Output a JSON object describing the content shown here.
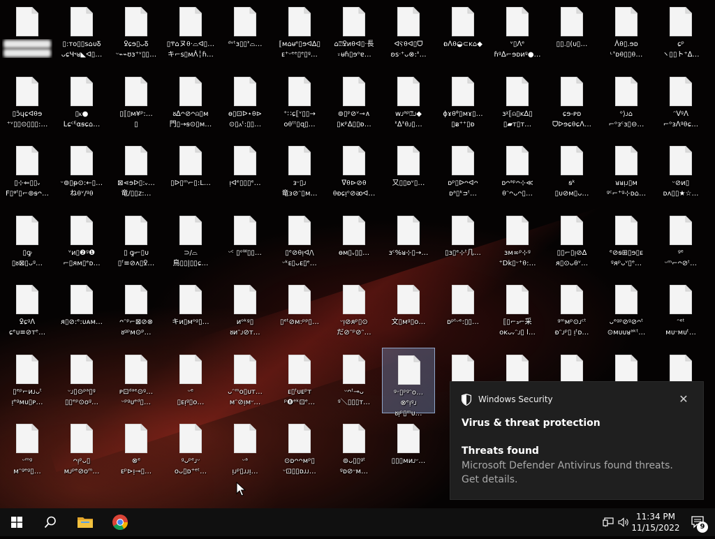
{
  "desktop": {
    "icons": [
      [
        "▪▪▪▪▪▪▪▪▪",
        "▪▪▪▪▪▪▪▪▪"
      ],
      [
        "▯:ᴛᴏ▯▯ꜱ⌂ᴜꝽ",
        "ᴗɕЧ˞ᴚ◣ᐊ▯…"
      ],
      [
        "ꝿɕɘ▯ᴗꝽ",
        "ᵕ⌁⌁ʊɜ⁺ᵛ▯▯…"
      ],
      [
        "▯ⰹ⌂ヌ⍬·⌓ᐊ▯…",
        "キ⌐ꜱ▯ᴍᐲ╎ɦ…"
      ],
      [
        "ᵈᵛᵗɜ▯▯ᕑ⌓…",
        ""
      ],
      [
        "⟦ᴍ⌂ᵾᵉ▯ɘᐊ∆▯",
        "ᴇ⁺ᵕᵉᵉ▯ᵉ▯ᵍ…"
      ],
      [
        "⌂⍰ꝿᴎ⍬ᐊ▯·長",
        "⍤ᵾɦ▯ɘᵒɐ…"
      ],
      [
        "ᐊⲊ⍬ᐊ▯ᗜ",
        "ʚꜱᐧ⁺ᴗ⊗:ᕑ…"
      ],
      [
        "ᴆᐱ⍬◒⊂ᴋ⌂◆",
        ""
      ],
      [
        "ᵛ▯ᐱᵉ",
        "ɦᵍᐃ⌐ɘᴅᴎᵍ●…"
      ],
      [
        "▯▯.▯(ᴜ▯…",
        ""
      ],
      [
        "ᐲ⍬▯.ɘᴅ",
        "ᶫᐪᴅ⍬▯▯⍬…"
      ],
      [
        "ɕᵖ",
        "ヽ▯▯ト⁺ᐃ…"
      ],
      [
        "▯ɔ̃ɥɕᐊ⍬ɘ",
        "⁺ᵛ▯▯⊙▯▯▯:…"
      ],
      [
        "▯ⲕ●",
        "ᒪɕᶜᴱ⍺ꞩɕ⌂…"
      ],
      [
        "▯⟦▯ᴍ¥ᵖ:…",
        "▯"
      ],
      [
        "ᴕᐃᴖ⊘ᴖ⍝▯ᴍ",
        "門▯→ꞩ⊙▯ᴍ…"
      ],
      [
        "ɵ▯⊡ᐅ⋆⍬⊳",
        "⊙▯ⲁᵗ:▯▯…"
      ],
      [
        "⁺∷ɕ⟦ᵛ▯▯→",
        "ᴏ⍬ᵗᵗ▯ɋ▯…"
      ],
      [
        "⊚▯ᵖ⊘ᵛ⊸∧",
        "▯ᴋᵖᐃ▯▯ᴆ…"
      ],
      [
        "ᴡᴊᵃᵖ⍰ᴊ◆",
        "ᕑᐃᕑ⍬ᴊ▯…"
      ],
      [
        "ɸɤ⍬ᶿ▯ᴍɤ▯…",
        "▯ᴃ⁺⁺▯ᴆ"
      ],
      [
        "ɜᵡ⟦⍝▯ᴋᐃ▯",
        "▯▰ᴛ▯ᴛ…"
      ],
      [
        "ɕɘ-ᴘᴅ",
        "ᗜᐅɘɕ⍬ɕᐱ…"
      ],
      [
        "ᵒ⟩ᴊ⌂",
        "⌐ᵒᴈᶜɜ▯⊖…"
      ],
      [
        "ᵔᐯᵍᐱ",
        "⌐ᵒᴈᐱᵍ⍬ɕ…"
      ],
      [
        "▯⊹⇐▯▯ᵥ",
        "F▯ᵠᶠ▯⌐⊚ꞩᴖ…"
      ],
      [
        "ᵕ⊚▯ᵽ⊙:←▯…",
        "ね⍬ᵛ/ᵍ⍬"
      ],
      [
        "⊠⋖ɘᐅ▯:ᵥ…",
        "竜∕▯▯ᴢ:…"
      ],
      [
        "▯ᐅ▯ᵐ⌐▯:L…",
        ""
      ],
      [
        "ᴉᐊᵉ▯▯▯ᵉ…",
        ""
      ],
      [
        "ᴈᵕ▯ᴊ",
        "竜ᴈ⊘ᵔ▯ᴍ…"
      ],
      [
        "ᐁ⍬⊳⊘⍬",
        "⍬ᴆɕᴉᵒ⊘ᴔᐊ…"
      ],
      [
        "又▯▯ᴅᵛ▯…",
        ""
      ],
      [
        "ᴅᵖ▯ᐅᴖᐊᴖ",
        "ᴅᵃ▯ᵏᴝᵗ…"
      ],
      [
        "ᴅᴖᵃᵖᴖ⊹≪",
        "⍬ᵔᴖᴗᴖ▯…"
      ],
      [
        "ꞩᵏ",
        "▯ᴜ⊘ᴍ▯ᴗ…"
      ],
      [
        "ᴚᴚᴉᴊ▯ᴍ",
        "ᵍᶜ⌐⁺ᵍ⊹ᴅ⌂…"
      ],
      [
        "ᵕ⊘ᴎ▯",
        "ᴅᴧ▯▯★☆…"
      ],
      [
        "▯ꝙ",
        "▯ᴕ⊠▯ᴗᵍ…"
      ],
      [
        "ᵛᴎ▯❷ᵍ❶",
        "⌐▯ᴙᴍ▯ᵉᴅ…"
      ],
      [
        "▯ ꝙ⌐▯ᴜ",
        "▯ᶠ≡⊘ᴧ▯ꝿ…"
      ],
      [
        "⊃/⌓",
        "鳥▯▯|▯▯ɕ…"
      ],
      [
        "ᵕᶜ ▯ᵒᵂ▯▯…",
        ""
      ],
      [
        "▯ᵉ⊘⍬ᴉᐊ/\\",
        "ᵕᵏᴇ▯ᴗᴇ▯ᵉ…"
      ],
      [
        "ɵᴍ▯ᵥ▯▯…",
        ""
      ],
      [
        "ɜᶜ%ᴚ⊹▯→…",
        ""
      ],
      [
        "▯ɜ▯ᵉ⊹ᵗ几…",
        ""
      ],
      [
        "ɜᴍ∞ᵖ⊹ᵍ",
        "⁺Dk▯ᵕ⁺⍬:…"
      ],
      [
        "▯▯⌐▯ᴉ⊘∆",
        "ᴙ▯⊙ᴗ⍬ᵛ…"
      ],
      [
        "ᵉ⊘ꞩ⊞▯ɘ▯ᴇ",
        "ᵍᴙᵖᴗᵛ▯ᵉ…"
      ],
      [
        "ᵍᵉ",
        "ᵕᵐ⌐ᴖ⊘ᵗ…"
      ],
      [
        "ꝿɕᵍᐱ",
        "ɕᵉᴜ≡⊘ᴛᵉ…"
      ],
      [
        "ᴙ▯⊘:ᵉ:ᴜᴀᴍ…",
        ""
      ],
      [
        "ᴖᵔᵖ⌐⊠⊘⊗",
        "ᴕᵍᵖᴍ⊙ᵖ…"
      ],
      [
        "キᴎ▯ᴍᵒᵍ▯…",
        ""
      ],
      [
        "ᴎᵒᵏᵍ▯",
        "ᴕᴎᵔᴊ⊘ᴛ…"
      ],
      [
        "▯ᵉᵗ⊘ᴍ:ᵖᵖ▯…",
        ""
      ],
      [
        "ᵕᴉ⊘ᴙᵖ▯⊙",
        "だ⊘ᵔᵖ⊘ᵔ…"
      ],
      [
        "文▯ᴍᵍ▯ᴏ…",
        ""
      ],
      [
        "ᴅᵖᵗᵕᵉ:▯▯…",
        ""
      ],
      [
        "⟦▯⌐₃⌐采",
        "ᴏᴋᴗᵥᵔᴊ▯ l…"
      ],
      [
        "ᵍᵐᴍᵖ⊙ᴊᶜᵗ",
        "ᴆᵔᴊᵖ▯ ᴉᵗᴅ…"
      ],
      [
        "ᴗᵉᵍᵖ⊘ᵍ⊘ᴖᵗ",
        "⊙ᴍᴜᴜᴚᵃᵏᵗ…"
      ],
      [
        "ᵔᵉᵗ",
        "ᴍᴜᵕᴍᴜᵗ…"
      ],
      [
        "▯ᵉᵖ⌐ᴎᴊᴗᵗ",
        "ᴉᵉᵍᴍᴜ▯ᴘ…"
      ],
      [
        "ᵕᴊ▯⊙ᵖᵃ▯ᵍ",
        "▯▯ᵉᵖ⊙ᴏᵍ…"
      ],
      [
        "ᴘ⊡ᵈᵃᵉ⊙ᵍ…",
        "ᵕᵖᵍᴜᵉᵈ▯…"
      ],
      [
        "ᵕᵉ",
        "▯ᴇᴉᵍ▯ᴏ…"
      ],
      [
        "ᴗᵔᵐᴏ▯ᴜᴛ…",
        "ᴍᵔ⊘ᴉᴍᵕ…"
      ],
      [
        "ᴇ▯ᵗᴜᴇᵖᴛ",
        "ᵖ❽ᵉᵏ⊡ᵉ…"
      ],
      [
        "ᵕᴖᵗ⊸ᴗ",
        "ᵍ＼▯▯▯ᴛ…"
      ],
      [
        "ᵍᵕ▯ᵖᵍᵔᴏ…",
        "⊗ᵉᴉᵍᴊ",
        "ᴕᴉᵖ▯ᵐᴜ…"
      ],
      [
        "",
        ""
      ],
      [
        "",
        ""
      ],
      [
        "",
        ""
      ],
      [
        "",
        ""
      ],
      [
        "",
        ""
      ],
      [
        "ᵕᵐᵍ",
        "ᴍᵔᵍᵉᵍ▯…"
      ],
      [
        "ᴖᴉᵖᴗ▯",
        "ᴍᴊᵖᵉ⊘ᴏᵐ…"
      ],
      [
        "⊗ᵉ",
        "ᴇᵖ⊳ᴉ⊸▯…"
      ],
      [
        "ᵍᴗᵖᵉᴊᵕ",
        "ᴏᴗ▯ᴅ⁺ᵉᵗ…"
      ],
      [
        "ᵕᵃ",
        "ᴉᴊᵖ▯ᴊᴊᴉ…"
      ],
      [
        "⊙ᴅᴖᴖᴍᵖ▯",
        "ᵕ⊡▯▯ᴅᴊᴊ…"
      ],
      [
        "⊚ᴗ▯▯ᵍᵗ",
        "ᵍᴅ⊘ᵕᴍ…"
      ],
      [
        "▯▯▯ᴍᴎᴊᵕ…",
        ""
      ],
      [
        "▯ᴍ",
        "ᴛ▯"
      ]
    ]
  },
  "toast": {
    "app_name": "Windows Security",
    "title": "Virus & threat protection",
    "heading": "Threats found",
    "body": "Microsoft Defender Antivirus found threats. Get details.",
    "close_glyph": "✕"
  },
  "taskbar": {
    "time": "11:34 PM",
    "date": "11/15/2022",
    "notification_count": "9"
  },
  "colors": {
    "accent_toast_bg": "#1f1f1f",
    "taskbar_bg": "#101010",
    "folder_yellow": "#f3c23f",
    "chrome_red": "#db4437",
    "chrome_green": "#0f9d58",
    "chrome_yellow": "#f4b400",
    "chrome_blue": "#4285f4"
  }
}
